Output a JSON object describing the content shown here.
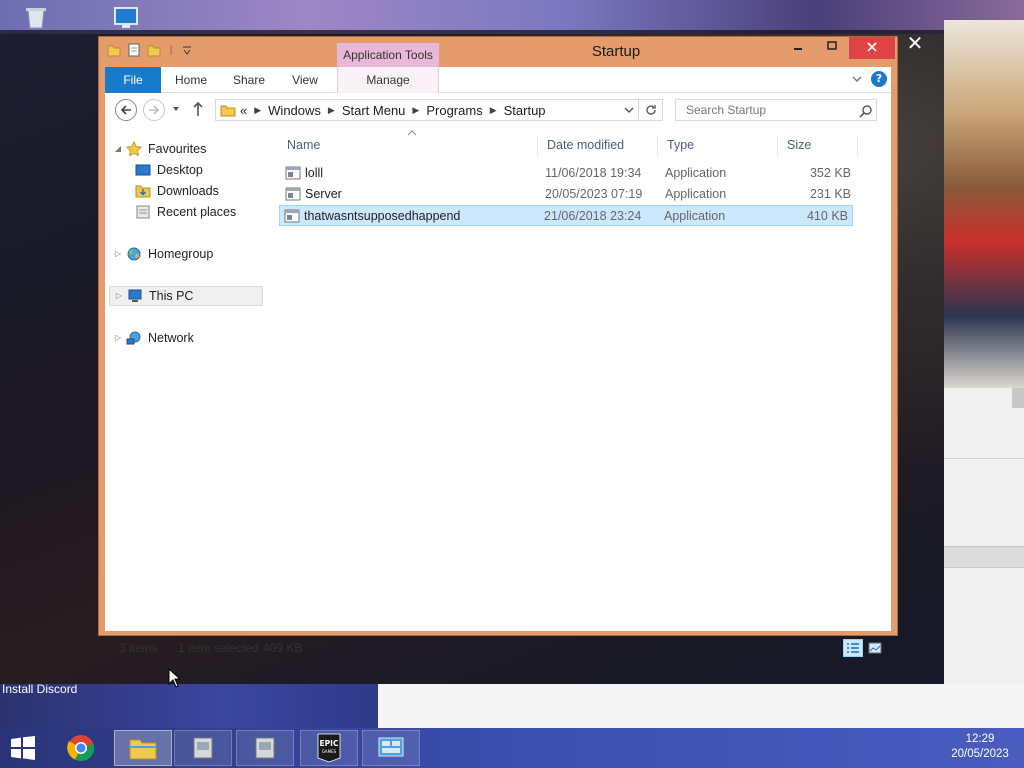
{
  "window": {
    "title": "Startup",
    "contextual_tab_group": "Application Tools",
    "overlay_close_glyph": "✕"
  },
  "ribbon": {
    "tabs": [
      {
        "label": "File"
      },
      {
        "label": "Home"
      },
      {
        "label": "Share"
      },
      {
        "label": "View"
      },
      {
        "label": "Manage"
      }
    ]
  },
  "address": {
    "overflow": "«",
    "crumbs": [
      "Windows",
      "Start Menu",
      "Programs",
      "Startup"
    ],
    "search_placeholder": "Search Startup"
  },
  "navpane": {
    "favourites": "Favourites",
    "desktop": "Desktop",
    "downloads": "Downloads",
    "recent": "Recent places",
    "homegroup": "Homegroup",
    "thispc": "This PC",
    "network": "Network"
  },
  "columns": {
    "name": "Name",
    "date": "Date modified",
    "type": "Type",
    "size": "Size"
  },
  "files": [
    {
      "name": "lolll",
      "date": "11/06/2018 19:34",
      "type": "Application",
      "size": "352 KB",
      "selected": false
    },
    {
      "name": "Server",
      "date": "20/05/2023 07:19",
      "type": "Application",
      "size": "231 KB",
      "selected": false
    },
    {
      "name": "thatwasntsupposedhappend",
      "date": "21/06/2018 23:24",
      "type": "Application",
      "size": "410 KB",
      "selected": true
    }
  ],
  "status": {
    "count": "3 items",
    "selection": "1 item selected",
    "selection_size": "409 KB"
  },
  "desktop": {
    "install_label": "Install Discord"
  },
  "taskbar": {
    "apps": [
      "chrome-icon",
      "file-explorer-icon",
      "installer-icon",
      "installer-icon",
      "epic-games-icon",
      "control-panel-icon"
    ],
    "epic_label": "EPIC",
    "epic_sub": "GAMES"
  },
  "clock": {
    "time": "12:29",
    "date": "20/05/2023"
  },
  "colors": {
    "window_frame": "#e59c6c",
    "file_tab": "#1979ca",
    "context_tab": "#e8b8d8",
    "selection": "#cce8ff",
    "close_button": "#e04343"
  }
}
